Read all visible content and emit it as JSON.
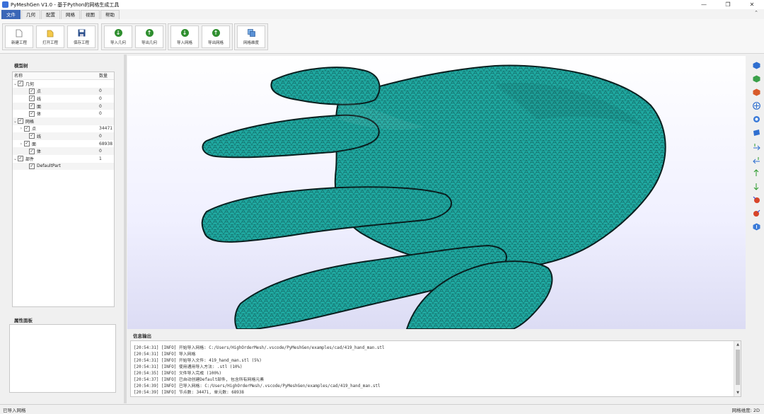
{
  "window": {
    "title": "PyMeshGen V1.0 - 基于Python的网格生成工具"
  },
  "window_controls": {
    "minimize": "—",
    "maximize": "❐",
    "close": "✕"
  },
  "menu": {
    "tabs": [
      "文件",
      "几何",
      "配置",
      "网格",
      "视图",
      "帮助"
    ],
    "active": "文件",
    "collapse_glyph": "⌃"
  },
  "toolbar": {
    "new_project": "新建工程",
    "open_project": "打开工程",
    "save_project": "保存工程",
    "import_geometry": "导入几何",
    "export_geometry": "导出几何",
    "import_mesh": "导入网格",
    "export_mesh": "导出网格",
    "mesh_dimension": "网格维度"
  },
  "model_tree": {
    "title": "模型树",
    "col_name": "名称",
    "col_count": "数量",
    "rows": [
      {
        "label": "几何",
        "count": ""
      },
      {
        "label": "点",
        "count": "0"
      },
      {
        "label": "线",
        "count": "0"
      },
      {
        "label": "面",
        "count": "0"
      },
      {
        "label": "体",
        "count": "0"
      },
      {
        "label": "网格",
        "count": ""
      },
      {
        "label": "点",
        "count": "34471"
      },
      {
        "label": "线",
        "count": "0"
      },
      {
        "label": "面",
        "count": "68938"
      },
      {
        "label": "体",
        "count": "0"
      },
      {
        "label": "部件",
        "count": "1"
      },
      {
        "label": "DefaultPart",
        "count": ""
      }
    ]
  },
  "properties": {
    "title": "属性面板"
  },
  "log": {
    "title": "信息输出",
    "lines": [
      "[20:54:31] [INFO] 开始导入网格: C:/Users/HighOrderMesh/.vscode/PyMeshGen/examples/cad/419_hand_man.stl",
      "[20:54:31] [INFO] 导入网格",
      "[20:54:31] [INFO] 开始导入文件: 419_hand_man.stl (5%)",
      "[20:54:31] [INFO] 使用通用导入方法: .stl (10%)",
      "[20:54:35] [INFO] 文件导入完成 (100%)",
      "[20:54:37] [INFO] 已自动创建Default部件, 包含所有网格元素",
      "[20:54:39] [INFO] 已导入网格: C:/Users/HighOrderMesh/.vscode/PyMeshGen/examples/cad/419_hand_man.stl",
      "[20:54:39] [INFO] 节点数: 34471, 单元数: 68938"
    ]
  },
  "status": {
    "left": "已导入网格",
    "right": "网格维度: 2D"
  },
  "colors": {
    "mesh": "#1fa8a0",
    "mesh_edge": "#0a2a2a",
    "active_tab": "#3b67b7"
  }
}
